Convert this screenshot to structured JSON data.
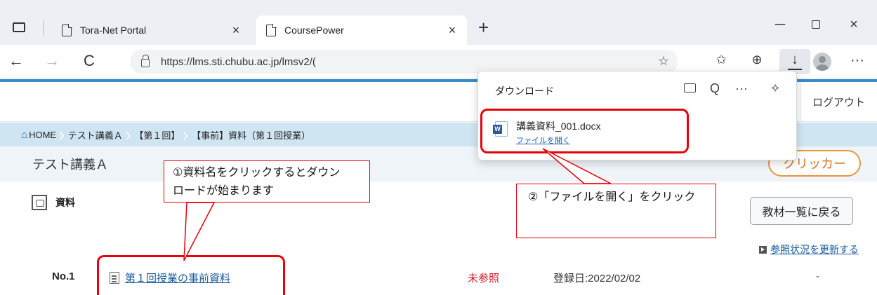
{
  "browser": {
    "tabs": [
      {
        "title": "Tora-Net Portal",
        "close": "×"
      },
      {
        "title": "CoursePower",
        "close": "×"
      }
    ],
    "new_tab": "+",
    "window_controls": {
      "minimize": "─",
      "close": "×"
    },
    "address": {
      "url": "https://lms.sti.chubu.ac.jp/lmsv2/("
    },
    "icons": {
      "back": "arrow-left-icon",
      "forward": "arrow-right-icon",
      "reload": "reload-icon",
      "lock": "lock-icon",
      "add_favorite": "star-plus-icon",
      "favorites": "favorites-icon",
      "collections": "collections-icon",
      "downloads": "download-icon",
      "profile": "avatar-icon",
      "more": "more-icon"
    },
    "glyphs": {
      "back": "←",
      "forward": "→",
      "reload": "C",
      "add_favorite": "☆",
      "favorites": "✩",
      "collections": "⊕",
      "downloads": "↓",
      "more": "···"
    }
  },
  "downloads_panel": {
    "title": "ダウンロード",
    "glyphs": {
      "search": "Q",
      "more": "···",
      "pin": "✧"
    },
    "item": {
      "filename": "講義資料_001.docx",
      "action": "ファイルを開く"
    }
  },
  "page": {
    "header": {
      "logout": "ログアウト"
    },
    "breadcrumb": {
      "home_icon": "⌂",
      "home": "HOME",
      "items": [
        "テスト講義Ａ",
        "【第１回】",
        "【事前】資料（第１回授業）"
      ],
      "separator": "›"
    },
    "course": {
      "name": "テスト講義Ａ",
      "clicker": "クリッカー"
    },
    "materials": {
      "title": "資料",
      "back_button": "教材一覧に戻る",
      "refresh_link": "参照状況を更新する",
      "rows": [
        {
          "no": "No.1",
          "title": "第１回授業の事前資料",
          "status": "未参照",
          "date": "登録日:2022/02/02",
          "extra": "-"
        }
      ]
    }
  },
  "annotations": {
    "callout_1": {
      "line1": "①資料名をクリックするとダウン",
      "line2": "ロードが始まります"
    },
    "callout_2": "②「ファイルを開く」をクリック",
    "color": "#e8000b"
  }
}
